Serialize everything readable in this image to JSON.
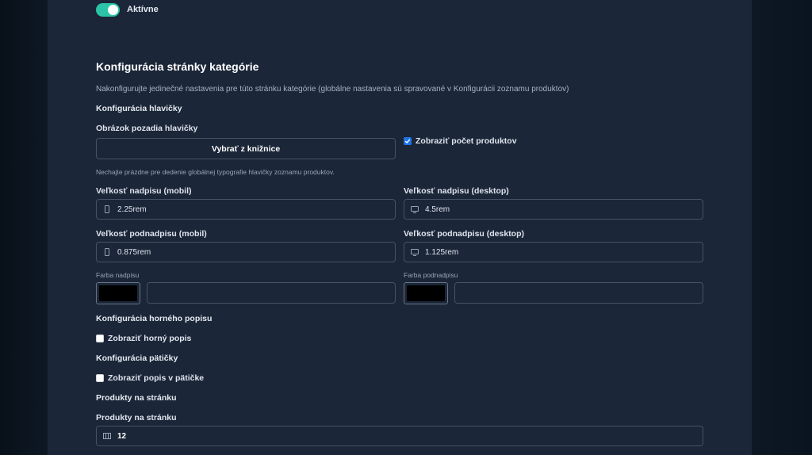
{
  "toggle": {
    "label": "Aktívne",
    "on": true
  },
  "section": {
    "title": "Konfigurácia stránky kategórie",
    "description": "Nakonfigurujte jedinečné nastavenia pre túto stránku kategórie (globálne nastavenia sú spravované v Konfigurácii zoznamu produktov)"
  },
  "header_config": {
    "title": "Konfigurácia hlavičky",
    "bg_image_label": "Obrázok pozadia hlavičky",
    "choose_button": "Vybrať z knižnice",
    "show_count_label": "Zobraziť počet produktov",
    "show_count_checked": true,
    "hint": "Nechajte prázdne pre dedenie globálnej typografie hlavičky zoznamu produktov.",
    "title_size_mobile": {
      "label": "Veľkosť nadpisu (mobil)",
      "value": "2.25rem",
      "icon": "mobile-icon"
    },
    "title_size_desktop": {
      "label": "Veľkosť nadpisu (desktop)",
      "value": "4.5rem",
      "icon": "desktop-icon"
    },
    "subtitle_size_mobile": {
      "label": "Veľkosť podnadpisu (mobil)",
      "value": "0.875rem",
      "icon": "mobile-icon"
    },
    "subtitle_size_desktop": {
      "label": "Veľkosť podnadpisu (desktop)",
      "value": "1.125rem",
      "icon": "desktop-icon"
    },
    "title_color": {
      "label": "Farba nadpisu",
      "swatch": "#000000",
      "value": ""
    },
    "subtitle_color": {
      "label": "Farba podnadpisu",
      "swatch": "#000000",
      "value": ""
    }
  },
  "top_desc_config": {
    "title": "Konfigurácia horného popisu",
    "checkbox_label": "Zobraziť horný popis",
    "checked": false
  },
  "footer_config": {
    "title": "Konfigurácia pätičky",
    "checkbox_label": "Zobraziť popis v pätičke",
    "checked": false
  },
  "products_per_page": {
    "title": "Produkty na stránku",
    "label": "Produkty na stránku",
    "value": "12",
    "icon": "grid-icon"
  },
  "colors": {
    "accent_toggle": "#2bc4a6",
    "checkbox": "#1e74e8",
    "panel": "#1b2638"
  }
}
